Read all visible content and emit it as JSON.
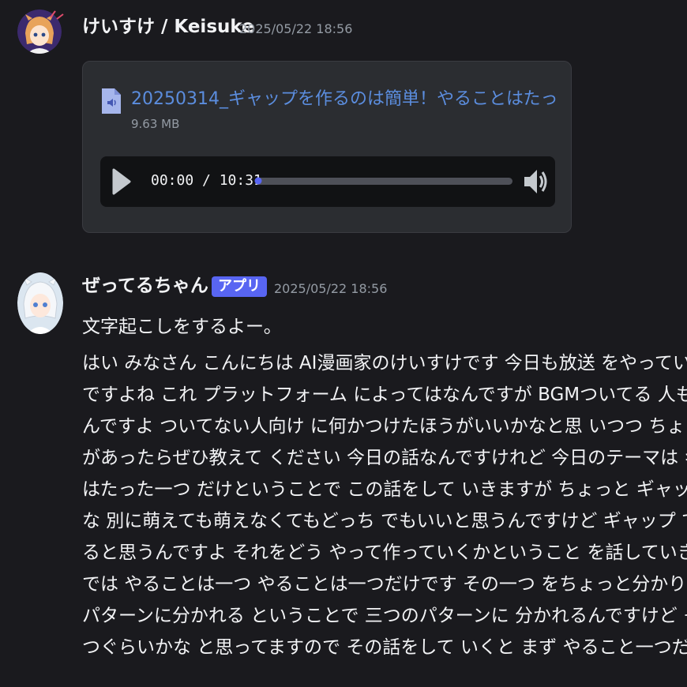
{
  "messages": {
    "first": {
      "username": "けいすけ / Keisuke",
      "timestamp": "2025/05/22 18:56",
      "attachment": {
        "icon": "audio-file-icon",
        "file_name": "20250314_ギャップを作るのは簡単！やることはたっ",
        "file_size": "9.63 MB",
        "player": {
          "time": "00:00 / 10:31",
          "progress": 0.0
        }
      }
    },
    "second": {
      "username": "ぜってるちゃん",
      "badge": "アプリ",
      "timestamp": "2025/05/22 18:56",
      "intro": "文字起こしをするよー。",
      "transcript_lines": [
        "はい みなさん こんにちは AI漫画家のけいすけです 今日も放送 をやっていく",
        "ですよね これ プラットフォーム によってはなんですが BGMついてる 人もい",
        "んですよ ついてない人向け に何かつけたほうがいいかなと思 いつつ ちょっ",
        "があったらぜひ教えて ください 今日の話なんですけれど 今日のテーマは ギ",
        "はたった一つ だけということで この話をして いきますが ちょっと ギャップ",
        "な 別に萌えても萌えなくてもどっち でもいいと思うんですけど ギャップ で",
        "ると思うんですよ それをどう やって作っていくかということ を話していき",
        "では やることは一つ やることは一つだけです その一つ をちょっと分かりや",
        "パターンに分かれる ということで 三つのパターンに 分かれるんですけど そ",
        "つぐらいかな と思ってますので その話をして いくと まず やること一つだけ"
      ]
    }
  },
  "colors": {
    "background": "#1a1a1e",
    "link": "#5b8dde",
    "accent": "#5865f2"
  }
}
